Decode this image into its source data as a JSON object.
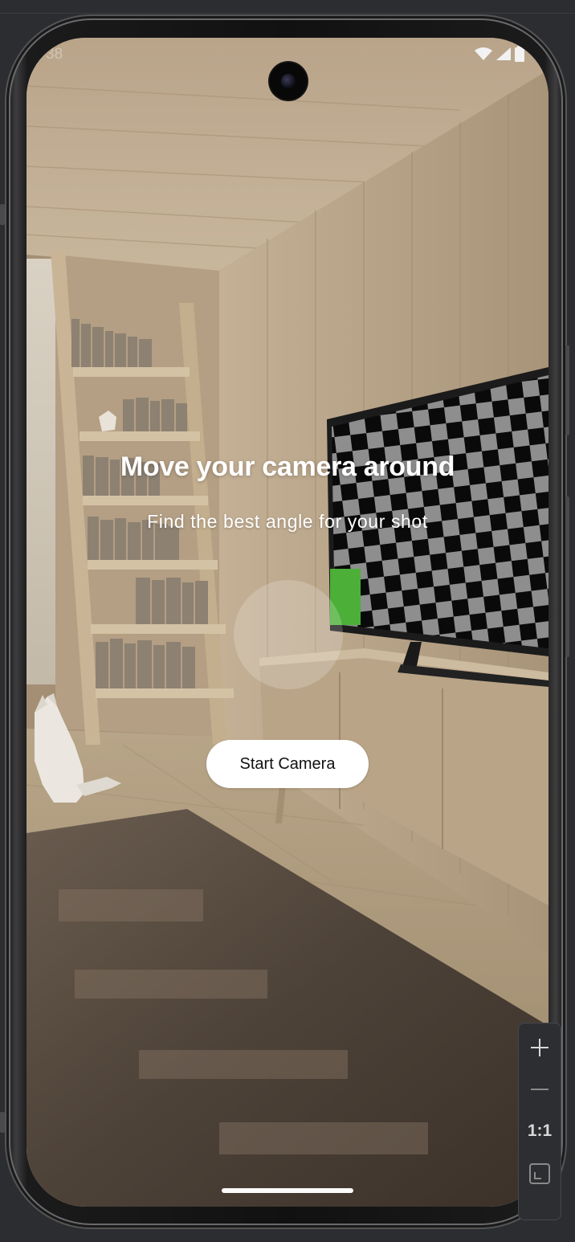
{
  "status_bar": {
    "time": "38",
    "icons": [
      "wifi-icon",
      "signal-icon",
      "battery-icon"
    ]
  },
  "main": {
    "title": "Move your camera around",
    "subtitle": "Find the best angle for your shot",
    "start_button_label": "Start Camera"
  },
  "zoom_controls": {
    "zoom_in_icon": "plus-icon",
    "zoom_out_icon": "minus-icon",
    "ratio_label": "1:1",
    "fit_icon": "fit-screen-icon"
  },
  "colors": {
    "button_background": "#ffffff",
    "button_text": "#111111",
    "title_text": "#ffffff",
    "overlay_circle": "rgba(255,255,255,0.2)",
    "tv_highlight": "#4caf38"
  }
}
